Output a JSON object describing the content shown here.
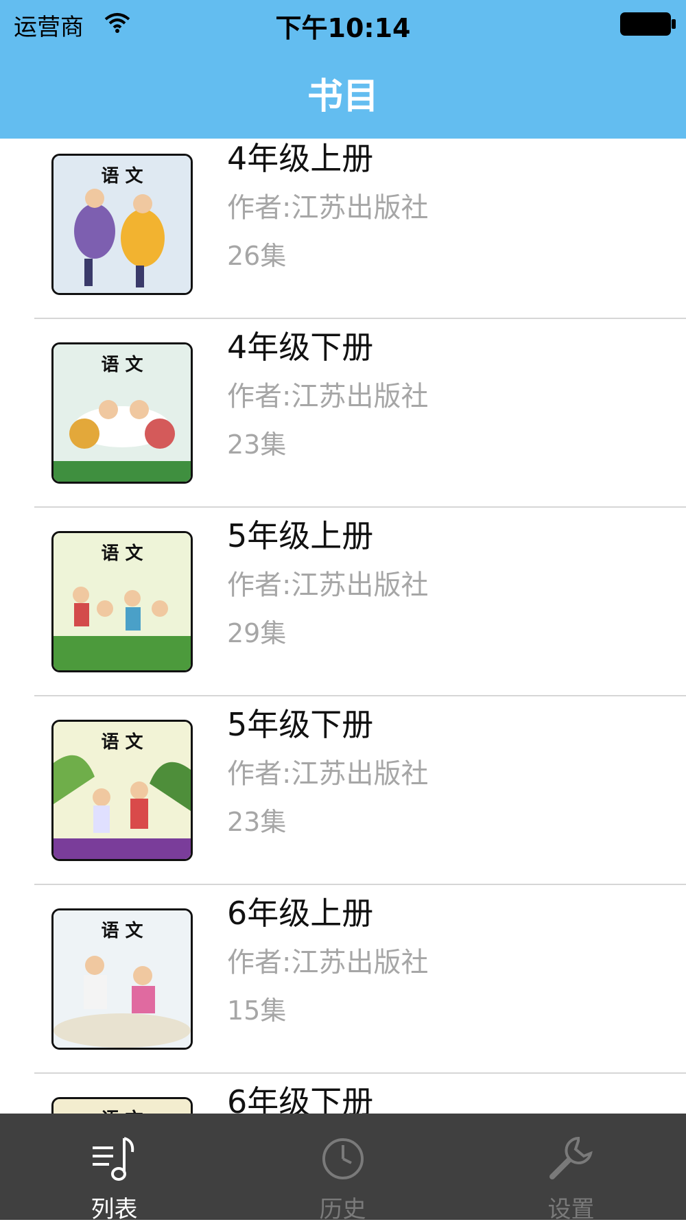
{
  "status_bar": {
    "carrier": "运营商",
    "time": "下午10:14"
  },
  "nav": {
    "title": "书目"
  },
  "books": [
    {
      "title": "4年级上册",
      "author": "作者:江苏出版社",
      "episodes": "26集",
      "cover_text": "语 文",
      "cover_bg": "#dfe9f2"
    },
    {
      "title": "4年级下册",
      "author": "作者:江苏出版社",
      "episodes": "23集",
      "cover_text": "语 文",
      "cover_bg": "#e4f0ea"
    },
    {
      "title": "5年级上册",
      "author": "作者:江苏出版社",
      "episodes": "29集",
      "cover_text": "语 文",
      "cover_bg": "#eef4d8"
    },
    {
      "title": "5年级下册",
      "author": "作者:江苏出版社",
      "episodes": "23集",
      "cover_text": "语 文",
      "cover_bg": "#f2f3d6"
    },
    {
      "title": "6年级上册",
      "author": "作者:江苏出版社",
      "episodes": "15集",
      "cover_text": "语 文",
      "cover_bg": "#eef3f6"
    },
    {
      "title": "6年级下册",
      "author": "",
      "episodes": "",
      "cover_text": "语 文",
      "cover_bg": "#f3edcf"
    }
  ],
  "tabs": [
    {
      "label": "列表",
      "icon": "music-list-icon",
      "active": true
    },
    {
      "label": "历史",
      "icon": "clock-icon",
      "active": false
    },
    {
      "label": "设置",
      "icon": "wrench-icon",
      "active": false
    }
  ],
  "colors": {
    "accent": "#63bdf0",
    "tab_bar": "#404040"
  }
}
